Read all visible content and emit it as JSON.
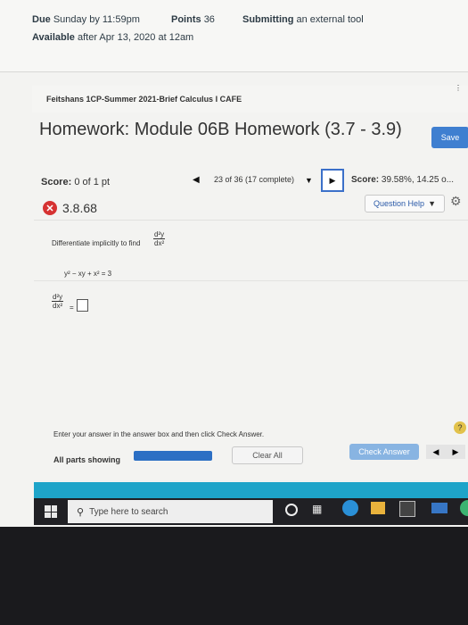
{
  "assignment": {
    "due_label": "Due",
    "due_value": "Sunday by 11:59pm",
    "points_label": "Points",
    "points_value": "36",
    "submitting_label": "Submitting",
    "submitting_value": "an external tool",
    "available_label": "Available",
    "available_value": "after Apr 13, 2020 at 12am"
  },
  "course": {
    "title": "Feitshans 1CP-Summer 2021-Brief Calculus I CAFE"
  },
  "homework": {
    "title": "Homework: Module 06B Homework (3.7 - 3.9)",
    "save_label": "Save",
    "score_label": "Score:",
    "score_value": "0 of 1 pt",
    "nav_count": "23 of 36 (17 complete)",
    "overall_score_label": "Score:",
    "overall_score_value": "39.58%, 14.25 o..."
  },
  "question": {
    "number": "3.8.68",
    "help_label": "Question Help",
    "instruction": "Differentiate implicitly to find",
    "derivative_num": "d²y",
    "derivative_den": "dx²",
    "equation": "y² − xy + x² = 3",
    "answer_num": "d²y",
    "answer_den": "dx²",
    "answer_eq": "="
  },
  "footer": {
    "instruction": "Enter your answer in the answer box and then click Check Answer.",
    "all_parts_label": "All parts showing",
    "clear_label": "Clear All",
    "check_label": "Check Answer",
    "help_glyph": "?"
  },
  "taskbar": {
    "search_placeholder": "Type here to search"
  },
  "glyphs": {
    "prev": "◀",
    "next": "▶",
    "drop": "▼",
    "x": "✕",
    "gear": "⚙",
    "search": "⚲",
    "kebab": "⋮"
  },
  "colors": {
    "save_button": "#3f7fd0",
    "check_button": "#88b4e2",
    "progress_bar": "#2c6fc4",
    "teal_band": "#1ea4c9",
    "incorrect_badge": "#d63232"
  }
}
